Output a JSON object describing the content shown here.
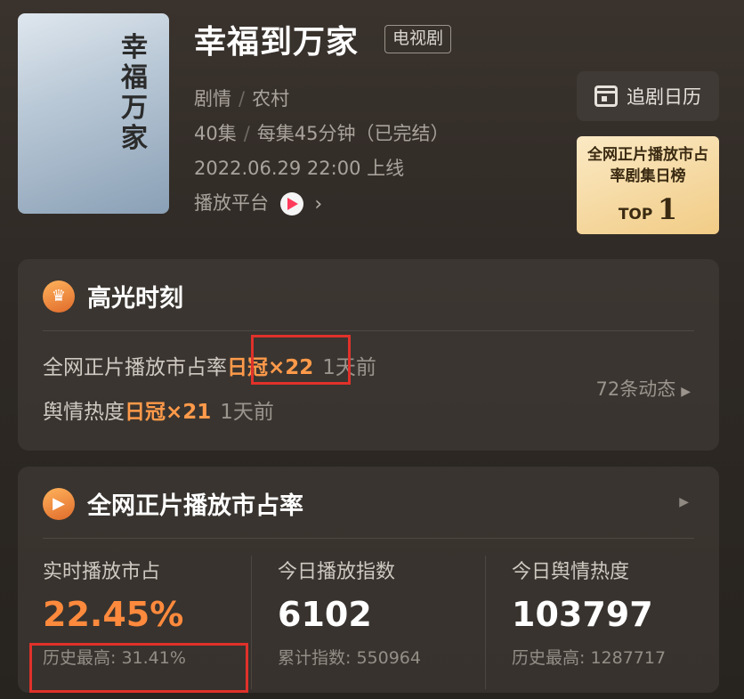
{
  "drama": {
    "title": "幸福到万家",
    "type_tag": "电视剧",
    "poster_calligraphy": "幸福\n万家",
    "genres": [
      "剧情",
      "农村"
    ],
    "episodes": "40集",
    "episode_info": "每集45分钟（已完结）",
    "release": "2022.06.29 22:00 上线",
    "platform_label": "播放平台"
  },
  "actions": {
    "calendar_label": "追剧日历"
  },
  "rank_badge": {
    "title": "全网正片播放市占率剧集日榜",
    "top_label": "TOP",
    "rank": "1"
  },
  "highlight": {
    "title": "高光时刻",
    "rows": [
      {
        "label": "全网正片播放市占率",
        "value": "日冠×22",
        "ago": "1天前"
      },
      {
        "label": "舆情热度",
        "value": "日冠×21",
        "ago": "1天前"
      }
    ],
    "more_label": "72条动态"
  },
  "market_share": {
    "title": "全网正片播放市占率",
    "stats": [
      {
        "label": "实时播放市占",
        "value": "22.45%",
        "sub": "历史最高: 31.41%"
      },
      {
        "label": "今日播放指数",
        "value": "6102",
        "sub": "累计指数: 550964"
      },
      {
        "label": "今日舆情热度",
        "value": "103797",
        "sub": "历史最高: 1287717"
      }
    ]
  },
  "colors": {
    "accent_orange": "#ff8a3d",
    "highlight_box": "#e0312a",
    "badge_gold": "#f1cc86"
  }
}
